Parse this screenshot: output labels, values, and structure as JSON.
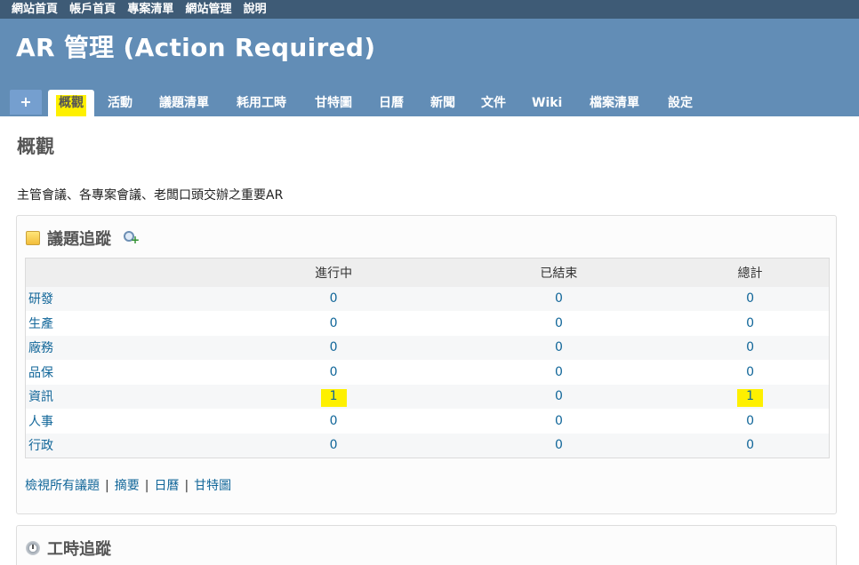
{
  "top_menu": [
    "網站首頁",
    "帳戶首頁",
    "專案清單",
    "網站管理",
    "說明"
  ],
  "header": {
    "title": "AR 管理 (Action Required)"
  },
  "main_menu": {
    "new_label": "+",
    "tabs": [
      "概觀",
      "活動",
      "議題清單",
      "耗用工時",
      "甘特圖",
      "日曆",
      "新聞",
      "文件",
      "Wiki",
      "檔案清單",
      "設定"
    ],
    "selected": "概觀"
  },
  "page": {
    "title": "概觀",
    "description": "主管會議、各專案會議、老闆口頭交辦之重要AR"
  },
  "issue_tracking": {
    "heading": "議題追蹤",
    "columns": [
      "",
      "進行中",
      "已結束",
      "總計"
    ],
    "rows": [
      {
        "name": "研發",
        "open": "0",
        "closed": "0",
        "total": "0"
      },
      {
        "name": "生產",
        "open": "0",
        "closed": "0",
        "total": "0"
      },
      {
        "name": "廠務",
        "open": "0",
        "closed": "0",
        "total": "0"
      },
      {
        "name": "品保",
        "open": "0",
        "closed": "0",
        "total": "0"
      },
      {
        "name": "資訊",
        "open": "1",
        "closed": "0",
        "total": "1"
      },
      {
        "name": "人事",
        "open": "0",
        "closed": "0",
        "total": "0"
      },
      {
        "name": "行政",
        "open": "0",
        "closed": "0",
        "total": "0"
      }
    ],
    "links": [
      "檢視所有議題",
      "摘要",
      "日曆",
      "甘特圖"
    ],
    "separator": "|"
  },
  "time_tracking": {
    "heading": "工時追蹤"
  },
  "colors": {
    "top_menu": "#3e5b76",
    "header": "#628db6",
    "highlight": "#fef000",
    "link": "#116699"
  }
}
